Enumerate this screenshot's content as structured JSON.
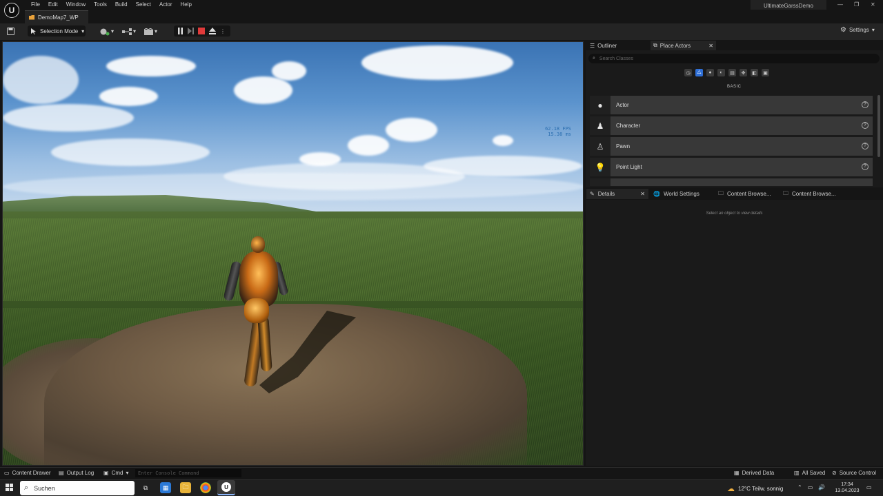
{
  "menu": {
    "items": [
      "File",
      "Edit",
      "Window",
      "Tools",
      "Build",
      "Select",
      "Actor",
      "Help"
    ]
  },
  "project": {
    "name": "UltimateGarssDemo"
  },
  "map_tab": {
    "label": "DemoMap7_WP"
  },
  "toolbar": {
    "selection_mode": "Selection Mode",
    "settings": "Settings"
  },
  "viewport": {
    "fps": "62.18 FPS",
    "ms": "15.38 ms"
  },
  "outliner": {
    "tabs": [
      "Outliner",
      "Place Actors"
    ],
    "search_placeholder": "Search Classes",
    "category": "BASIC",
    "actors": [
      "Actor",
      "Character",
      "Pawn",
      "Point Light"
    ]
  },
  "details": {
    "tabs": [
      "Details",
      "World Settings",
      "Content Browse...",
      "Content Browse..."
    ],
    "hint": "Select an object to view details"
  },
  "statusbar": {
    "content_drawer": "Content Drawer",
    "output_log": "Output Log",
    "cmd": "Cmd",
    "console_placeholder": "Enter Console Command",
    "derived_data": "Derived Data",
    "all_saved": "All Saved",
    "source_control": "Source Control"
  },
  "taskbar": {
    "search": "Suchen",
    "weather": "12°C  Teilw. sonnig",
    "time": "17:34",
    "date": "13.04.2023"
  },
  "colors": {
    "accent": "#2f6fd6",
    "stop": "#e03a3a",
    "folder": "#e8a13a"
  }
}
